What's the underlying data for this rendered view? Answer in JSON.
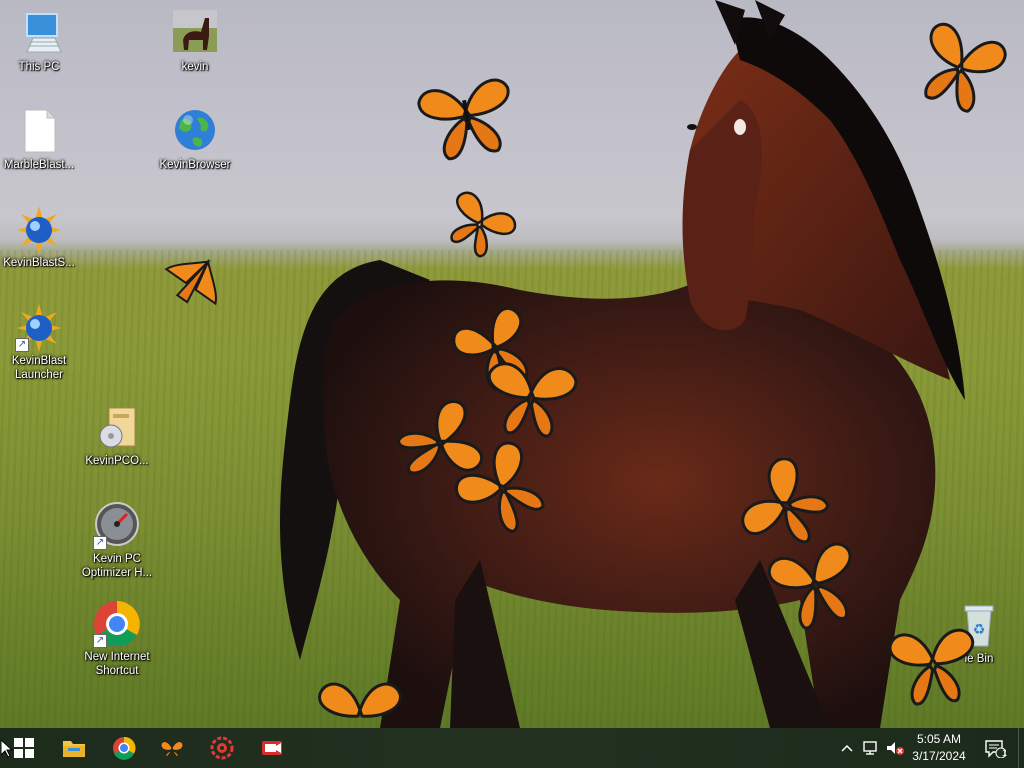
{
  "desktop": {
    "icons": [
      {
        "label": "This PC",
        "icon": "monitor-icon"
      },
      {
        "label": "kevin",
        "icon": "horse-photo-icon"
      },
      {
        "label": "MarbleBlast...",
        "icon": "blank-file-icon"
      },
      {
        "label": "KevinBrowser",
        "icon": "globe-icon"
      },
      {
        "label": "KevinBlastS...",
        "icon": "star-globe-icon"
      },
      {
        "label": "KevinBlast\nLauncher",
        "icon": "star-globe-icon"
      },
      {
        "label": "KevinPCO...",
        "icon": "installer-box-icon"
      },
      {
        "label": "Kevin PC\nOptimizer H...",
        "icon": "speedometer-icon"
      },
      {
        "label": "New Internet\nShortcut",
        "icon": "chrome-icon"
      },
      {
        "label": "le Bin",
        "icon": "recycle-bin-icon"
      }
    ]
  },
  "taskbar": {
    "pinned": [
      {
        "name": "start-button",
        "icon": "windows-logo-icon"
      },
      {
        "name": "file-explorer",
        "icon": "folder-icon"
      },
      {
        "name": "chrome",
        "icon": "chrome-icon"
      },
      {
        "name": "butterfly-app",
        "icon": "butterfly-icon"
      },
      {
        "name": "red-gear-app",
        "icon": "red-gear-icon"
      },
      {
        "name": "screen-recorder",
        "icon": "camera-icon"
      }
    ],
    "clock": {
      "time": "5:05 AM",
      "date": "3/17/2024"
    },
    "notification_count": "1"
  },
  "colors": {
    "butterfly_orange": "#f08a1a",
    "taskbar_bg": "#1f2e1e"
  }
}
